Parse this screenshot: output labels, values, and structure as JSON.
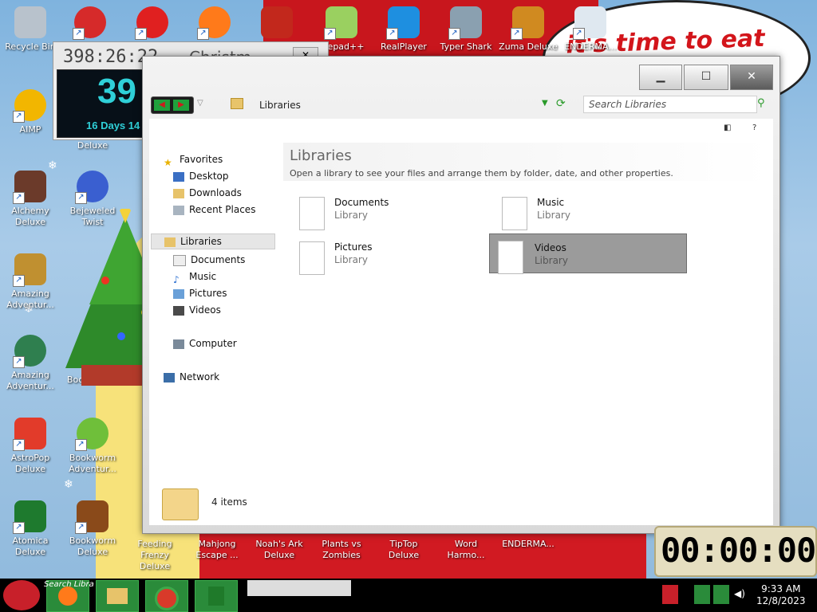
{
  "desktop": {
    "banner_text": "it's time to eat shit",
    "icons": [
      {
        "label": "Recycle Bin"
      },
      {
        "label": "AIMP"
      },
      {
        "label": "Alchemy Deluxe"
      },
      {
        "label": "Bejeweled Twist"
      },
      {
        "label": "Amazing Adventur..."
      },
      {
        "label": "Amazing Adventur..."
      },
      {
        "label": "Bookstor..."
      },
      {
        "label": "AstroPop Deluxe"
      },
      {
        "label": "Bookworm Adventur..."
      },
      {
        "label": "Atomica Deluxe"
      },
      {
        "label": "Bookworm Deluxe"
      },
      {
        "label": "Feeding Frenzy Deluxe"
      },
      {
        "label": "Mahjong Escape ..."
      },
      {
        "label": "Noah's Ark Deluxe"
      },
      {
        "label": "Plants vs Zombies"
      },
      {
        "label": "TipTop Deluxe"
      },
      {
        "label": "Word Harmo..."
      },
      {
        "label": "ENDERMA..."
      },
      {
        "label": "otepad++"
      },
      {
        "label": "RealPlayer"
      },
      {
        "label": "Typer Shark"
      },
      {
        "label": "Zuma Deluxe"
      },
      {
        "label": "ENDERMA..."
      },
      {
        "label": "Deluxe"
      }
    ]
  },
  "clock_widget": {
    "countdown": "398:26:22",
    "title": "Christm",
    "big": "39",
    "days": "16 Days 14"
  },
  "explorer": {
    "toolbar": {
      "breadcrumb": "Libraries",
      "search_placeholder": "Search Libraries"
    },
    "nav": {
      "favorites": "Favorites",
      "desktop": "Desktop",
      "downloads": "Downloads",
      "recent": "Recent Places",
      "libraries": "Libraries",
      "documents": "Documents",
      "music": "Music",
      "pictures": "Pictures",
      "videos": "Videos",
      "computer": "Computer",
      "network": "Network"
    },
    "main": {
      "title": "Libraries",
      "description": "Open a library to see your files and arrange them by folder, date, and other properties.",
      "libraries": [
        {
          "name": "Documents",
          "type": "Library"
        },
        {
          "name": "Music",
          "type": "Library"
        },
        {
          "name": "Pictures",
          "type": "Library"
        },
        {
          "name": "Videos",
          "type": "Library"
        }
      ]
    },
    "status": {
      "item_count": "4 items"
    }
  },
  "timer": {
    "display": "00:00:00"
  },
  "taskbar": {
    "search_text": "Search Libra",
    "time": "9:33 AM",
    "date": "12/8/2023"
  }
}
